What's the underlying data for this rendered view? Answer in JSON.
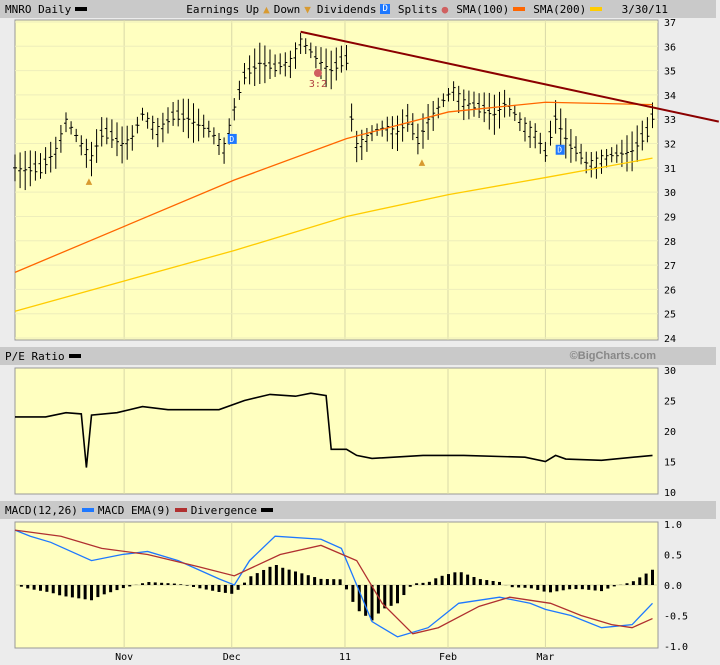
{
  "header": {
    "symbol": "MNRO Daily",
    "earnings_label": "Earnings",
    "up_label": "Up",
    "down_label": "Down",
    "dividends_label": "Dividends",
    "splits_label": "Splits",
    "sma100_label": "SMA(100)",
    "sma200_label": "SMA(200)",
    "date": "3/30/11"
  },
  "pe_header": {
    "label": "P/E Ratio",
    "credit": "©BigCharts.com"
  },
  "macd_header": {
    "macd_label": "MACD(12,26)",
    "ema_label": "MACD EMA(9)",
    "div_label": "Divergence"
  },
  "colors": {
    "panel": "#ffffc0",
    "sma100": "#ff6600",
    "sma200": "#ffcc00",
    "trend": "#8b0000",
    "macd": "#1e78ff",
    "ema": "#b03030",
    "divbar": "#000000"
  },
  "chart_data": [
    {
      "type": "ohlc",
      "title": "MNRO Daily",
      "ylim": [
        24,
        37
      ],
      "yticks": [
        24,
        25,
        26,
        27,
        28,
        29,
        30,
        31,
        32,
        33,
        34,
        35,
        36,
        37
      ],
      "xlim": [
        0,
        125
      ],
      "xticks": [
        {
          "day": 21.4,
          "label": "Nov"
        },
        {
          "day": 42.5,
          "label": "Dec"
        },
        {
          "day": 64.7,
          "label": "11"
        },
        {
          "day": 84.9,
          "label": "Feb"
        },
        {
          "day": 104,
          "label": "Mar"
        }
      ],
      "close": [
        [
          0,
          31
        ],
        [
          5,
          30.8
        ],
        [
          8,
          31.8
        ],
        [
          10,
          33
        ],
        [
          13,
          32
        ],
        [
          15,
          31.5
        ],
        [
          17,
          32.3
        ],
        [
          21,
          32
        ],
        [
          23,
          32.3
        ],
        [
          25,
          33.2
        ],
        [
          28,
          32.7
        ],
        [
          31,
          33
        ],
        [
          34,
          33
        ],
        [
          38,
          32.5
        ],
        [
          41,
          32
        ],
        [
          43,
          33.5
        ],
        [
          45,
          34.7
        ],
        [
          48,
          35.3
        ],
        [
          51,
          35
        ],
        [
          54,
          35.5
        ],
        [
          56,
          36.3
        ],
        [
          59,
          35.5
        ],
        [
          62,
          35
        ],
        [
          65,
          35.3
        ],
        [
          66,
          33
        ],
        [
          67,
          32
        ],
        [
          70,
          32.5
        ],
        [
          73,
          32.7
        ],
        [
          75,
          32.5
        ],
        [
          77,
          32.8
        ],
        [
          79,
          32
        ],
        [
          81,
          33
        ],
        [
          83,
          33.5
        ],
        [
          86,
          34.3
        ],
        [
          88,
          33.8
        ],
        [
          91,
          33.3
        ],
        [
          94,
          33.2
        ],
        [
          96,
          33.6
        ],
        [
          99,
          33
        ],
        [
          102,
          32.5
        ],
        [
          104,
          31.5
        ],
        [
          106,
          33
        ],
        [
          109,
          31.8
        ],
        [
          112,
          31.2
        ],
        [
          115,
          31.5
        ],
        [
          118,
          31.5
        ],
        [
          121,
          31.7
        ],
        [
          124,
          32.3
        ],
        [
          125,
          33
        ]
      ],
      "sma100": [
        [
          0,
          26.7
        ],
        [
          43,
          30.5
        ],
        [
          65,
          32.2
        ],
        [
          85,
          33.3
        ],
        [
          104,
          33.7
        ],
        [
          125,
          33.6
        ]
      ],
      "sma200": [
        [
          0,
          25.1
        ],
        [
          43,
          27.6
        ],
        [
          65,
          29
        ],
        [
          85,
          29.9
        ],
        [
          104,
          30.6
        ],
        [
          125,
          31.4
        ]
      ],
      "trendline": [
        [
          56,
          36.6
        ],
        [
          138,
          32.9
        ]
      ],
      "events": [
        {
          "type": "earnings-up",
          "day": 14.5
        },
        {
          "type": "earnings-up",
          "day": 79.8
        },
        {
          "type": "dividend",
          "day": 42.5,
          "label": "D"
        },
        {
          "type": "dividend",
          "day": 106.8,
          "label": "D"
        },
        {
          "type": "split",
          "day": 59.4,
          "label": "3:2"
        }
      ]
    },
    {
      "type": "line",
      "title": "P/E Ratio",
      "ylim": [
        10,
        30
      ],
      "yticks": [
        10,
        15,
        20,
        25,
        30
      ],
      "values": [
        [
          0,
          22.3
        ],
        [
          6,
          22.3
        ],
        [
          10,
          23
        ],
        [
          13,
          22.8
        ],
        [
          14,
          14
        ],
        [
          15,
          22.6
        ],
        [
          20,
          23
        ],
        [
          25,
          24
        ],
        [
          30,
          23.5
        ],
        [
          40,
          23.5
        ],
        [
          45,
          25
        ],
        [
          50,
          26
        ],
        [
          55,
          25.7
        ],
        [
          58,
          26.2
        ],
        [
          61,
          25.8
        ],
        [
          62,
          17
        ],
        [
          65,
          17
        ],
        [
          67,
          16
        ],
        [
          70,
          15.5
        ],
        [
          80,
          16
        ],
        [
          88,
          16
        ],
        [
          100,
          15.7
        ],
        [
          104,
          15
        ],
        [
          106,
          16
        ],
        [
          108,
          15.4
        ],
        [
          115,
          15.2
        ],
        [
          125,
          16
        ]
      ]
    },
    {
      "type": "line",
      "title": "MACD(12,26)",
      "ylim": [
        -1,
        1
      ],
      "yticks": [
        {
          "v": 1,
          "label": "1.0"
        },
        {
          "v": 0.5,
          "label": "0.5"
        },
        {
          "v": 0,
          "label": "0.0"
        },
        {
          "v": -0.5,
          "label": "-0.5"
        },
        {
          "v": -1,
          "label": "-1.0"
        }
      ],
      "series": [
        {
          "name": "MACD(12,26)",
          "values": [
            [
              0,
              0.9
            ],
            [
              3,
              0.8
            ],
            [
              7,
              0.7
            ],
            [
              15,
              0.4
            ],
            [
              21,
              0.5
            ],
            [
              26,
              0.55
            ],
            [
              32,
              0.4
            ],
            [
              40,
              0.1
            ],
            [
              43,
              0
            ],
            [
              46,
              0.4
            ],
            [
              51,
              0.8
            ],
            [
              60,
              0.75
            ],
            [
              64,
              0.6
            ],
            [
              67,
              0
            ],
            [
              70,
              -0.6
            ],
            [
              75,
              -0.85
            ],
            [
              81,
              -0.7
            ],
            [
              87,
              -0.3
            ],
            [
              95,
              -0.2
            ],
            [
              101,
              -0.3
            ],
            [
              104,
              -0.4
            ],
            [
              109,
              -0.5
            ],
            [
              115,
              -0.7
            ],
            [
              121,
              -0.65
            ],
            [
              125,
              -0.3
            ]
          ]
        },
        {
          "name": "MACD EMA(9)",
          "values": [
            [
              0,
              0.9
            ],
            [
              9,
              0.8
            ],
            [
              17,
              0.6
            ],
            [
              26,
              0.5
            ],
            [
              36,
              0.3
            ],
            [
              43,
              0.15
            ],
            [
              52,
              0.5
            ],
            [
              60,
              0.65
            ],
            [
              67,
              0.4
            ],
            [
              72,
              -0.3
            ],
            [
              78,
              -0.8
            ],
            [
              83,
              -0.7
            ],
            [
              91,
              -0.35
            ],
            [
              97,
              -0.2
            ],
            [
              105,
              -0.3
            ],
            [
              111,
              -0.5
            ],
            [
              117,
              -0.65
            ],
            [
              121,
              -0.7
            ],
            [
              125,
              -0.55
            ]
          ]
        }
      ]
    }
  ]
}
